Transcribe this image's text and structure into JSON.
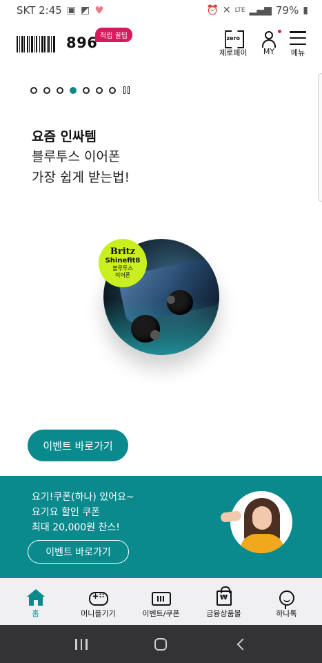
{
  "status_bar": {
    "carrier_time": "SKT 2:45",
    "network": "LTE",
    "battery": "79%"
  },
  "header": {
    "points": "896",
    "points_badge": "적립 꿀팁",
    "zero_pay_icon_text": "zero",
    "zero_pay_label": "제로페이",
    "my_label": "MY",
    "menu_label": "메뉴"
  },
  "carousel": {
    "total_pages": 7,
    "active_index": 3,
    "slide": {
      "title": "요즘 인싸템",
      "line1": "블루투스 이어폰",
      "line2": "가장 쉽게 받는법!",
      "badge_brand": "Britz",
      "badge_model": "Shinefit8",
      "badge_desc1": "블루투스",
      "badge_desc2": "이어폰",
      "cta_label": "이벤트 바로가기"
    }
  },
  "promo": {
    "line1": "요기!쿠폰(하나) 있어요~",
    "line2": "요기요 할인 쿠폰",
    "line3": "최대 20,000원 찬스!",
    "cta_label": "이벤트 바로가기"
  },
  "bottom_nav": {
    "items": [
      {
        "label": "홈",
        "icon": "home-icon",
        "active": true
      },
      {
        "label": "머니플기기",
        "icon": "gamepad-icon",
        "active": false
      },
      {
        "label": "이벤트/쿠폰",
        "icon": "ticket-icon",
        "active": false
      },
      {
        "label": "금융상품몰",
        "icon": "shopping-bag-icon",
        "active": false
      },
      {
        "label": "하나톡",
        "icon": "chat-icon",
        "active": false
      }
    ]
  },
  "colors": {
    "accent": "#0b8a8d",
    "badge_pink": "#d9195d",
    "lime": "#c9f01e"
  }
}
